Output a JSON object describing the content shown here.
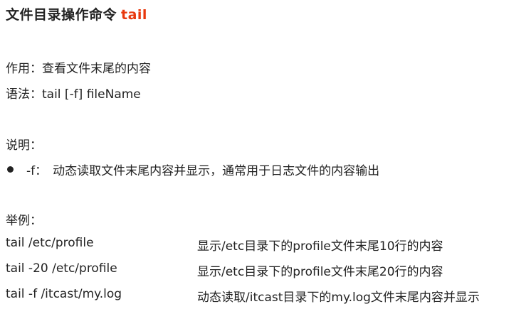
{
  "title": {
    "text": "文件目录操作命令",
    "command": "tail"
  },
  "usage": {
    "purpose": "作用：查看文件末尾的内容",
    "syntax": "语法：tail [-f] fileName"
  },
  "explanation": {
    "heading": "说明：",
    "options": [
      {
        "flag": "-f：",
        "text": "动态读取文件末尾内容并显示，通常用于日志文件的内容输出"
      }
    ]
  },
  "examples": {
    "heading": "举例：",
    "rows": [
      {
        "command": "tail /etc/profile",
        "description": "显示/etc目录下的profile文件末尾10行的内容"
      },
      {
        "command": "tail -20 /etc/profile",
        "description": "显示/etc目录下的profile文件末尾20行的内容"
      },
      {
        "command": "tail -f /itcast/my.log",
        "description": "动态读取/itcast目录下的my.log文件末尾内容并显示"
      }
    ]
  }
}
